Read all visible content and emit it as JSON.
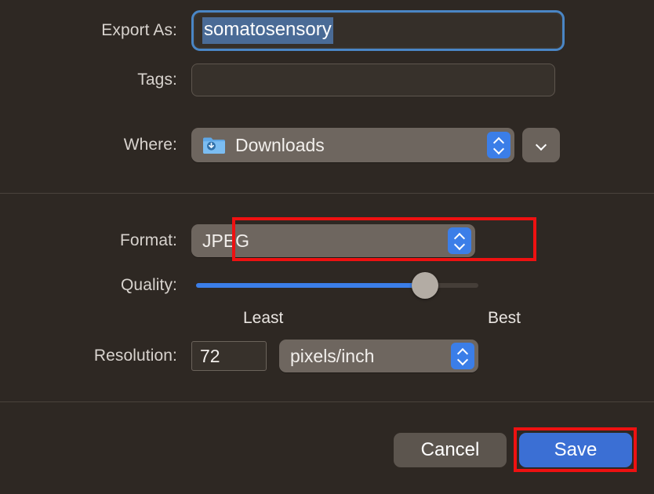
{
  "dialog": {
    "background_color": "#2e2823",
    "accent_color": "#3b7ee8"
  },
  "name_row": {
    "label": "Export As:",
    "value": "somatosensory",
    "selected": true
  },
  "tags_row": {
    "label": "Tags:",
    "value": "",
    "placeholder": ""
  },
  "where_row": {
    "label": "Where:",
    "value": "Downloads",
    "icon": "downloads-folder-icon",
    "stepper_icon": "up-down-chevron-icon",
    "disclosure_icon": "chevron-down-icon"
  },
  "format_row": {
    "label": "Format:",
    "value": "JPEG",
    "stepper_icon": "up-down-chevron-icon"
  },
  "quality_row": {
    "label": "Quality:",
    "value_percent": 81,
    "least_label": "Least",
    "best_label": "Best"
  },
  "resolution_row": {
    "label": "Resolution:",
    "value": "72",
    "unit": "pixels/inch",
    "stepper_icon": "up-down-chevron-icon"
  },
  "footer": {
    "cancel_label": "Cancel",
    "save_label": "Save"
  },
  "annotations": {
    "color": "#ee1111",
    "format_box": "highlight-format-dropdown",
    "save_box": "highlight-save-button"
  }
}
